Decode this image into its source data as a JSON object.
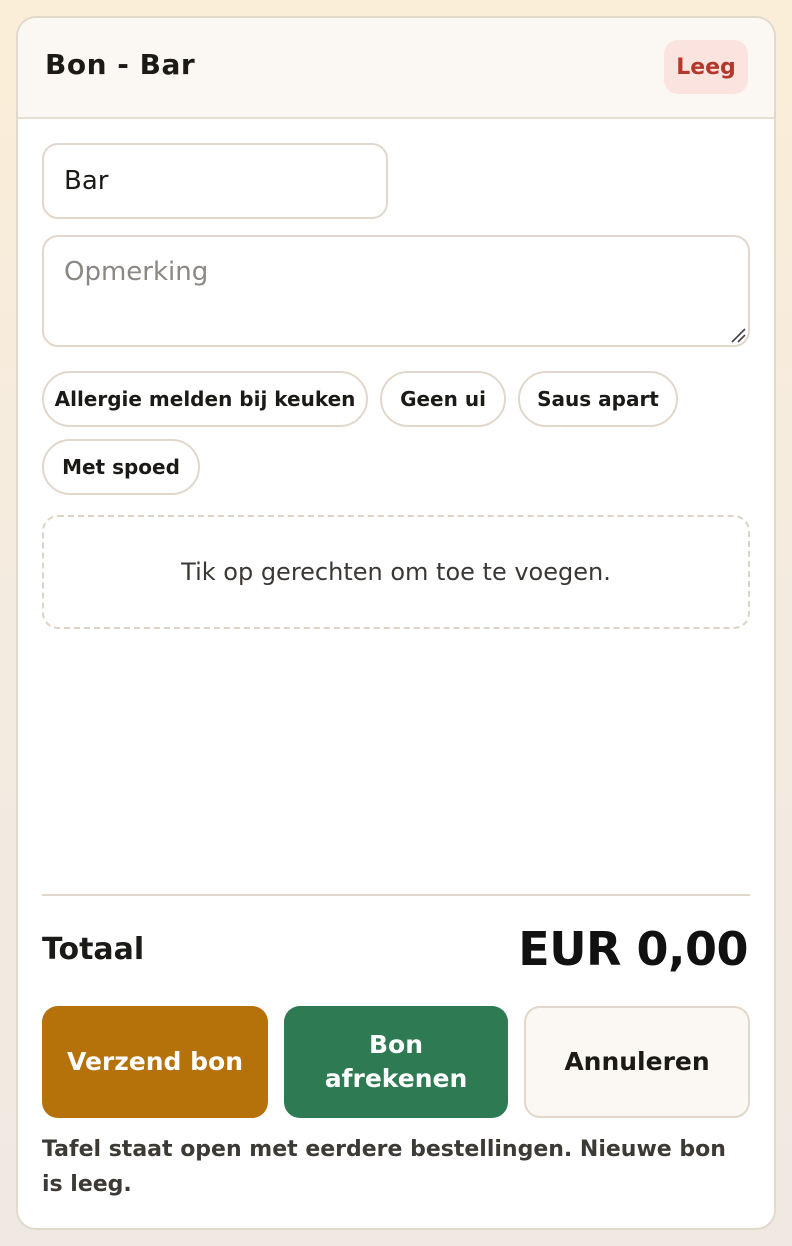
{
  "header": {
    "title": "Bon - Bar",
    "badge": "Leeg"
  },
  "form": {
    "name_value": "Bar",
    "note_placeholder": "Opmerking"
  },
  "chips": [
    "Allergie melden bij keuken",
    "Geen ui",
    "Saus apart",
    "Met spoed"
  ],
  "empty_state": "Tik op gerechten om toe te voegen.",
  "totals": {
    "label": "Totaal",
    "value": "EUR 0,00"
  },
  "actions": {
    "send": "Verzend bon",
    "pay": "Bon afrekenen",
    "cancel": "Annuleren"
  },
  "footnote": "Tafel staat open met eerdere bestellingen. Nieuwe bon is leeg.",
  "colors": {
    "send": "#b5710a",
    "pay": "#2d7a53",
    "badge_bg": "#fbe3df",
    "badge_text": "#b3382c"
  }
}
